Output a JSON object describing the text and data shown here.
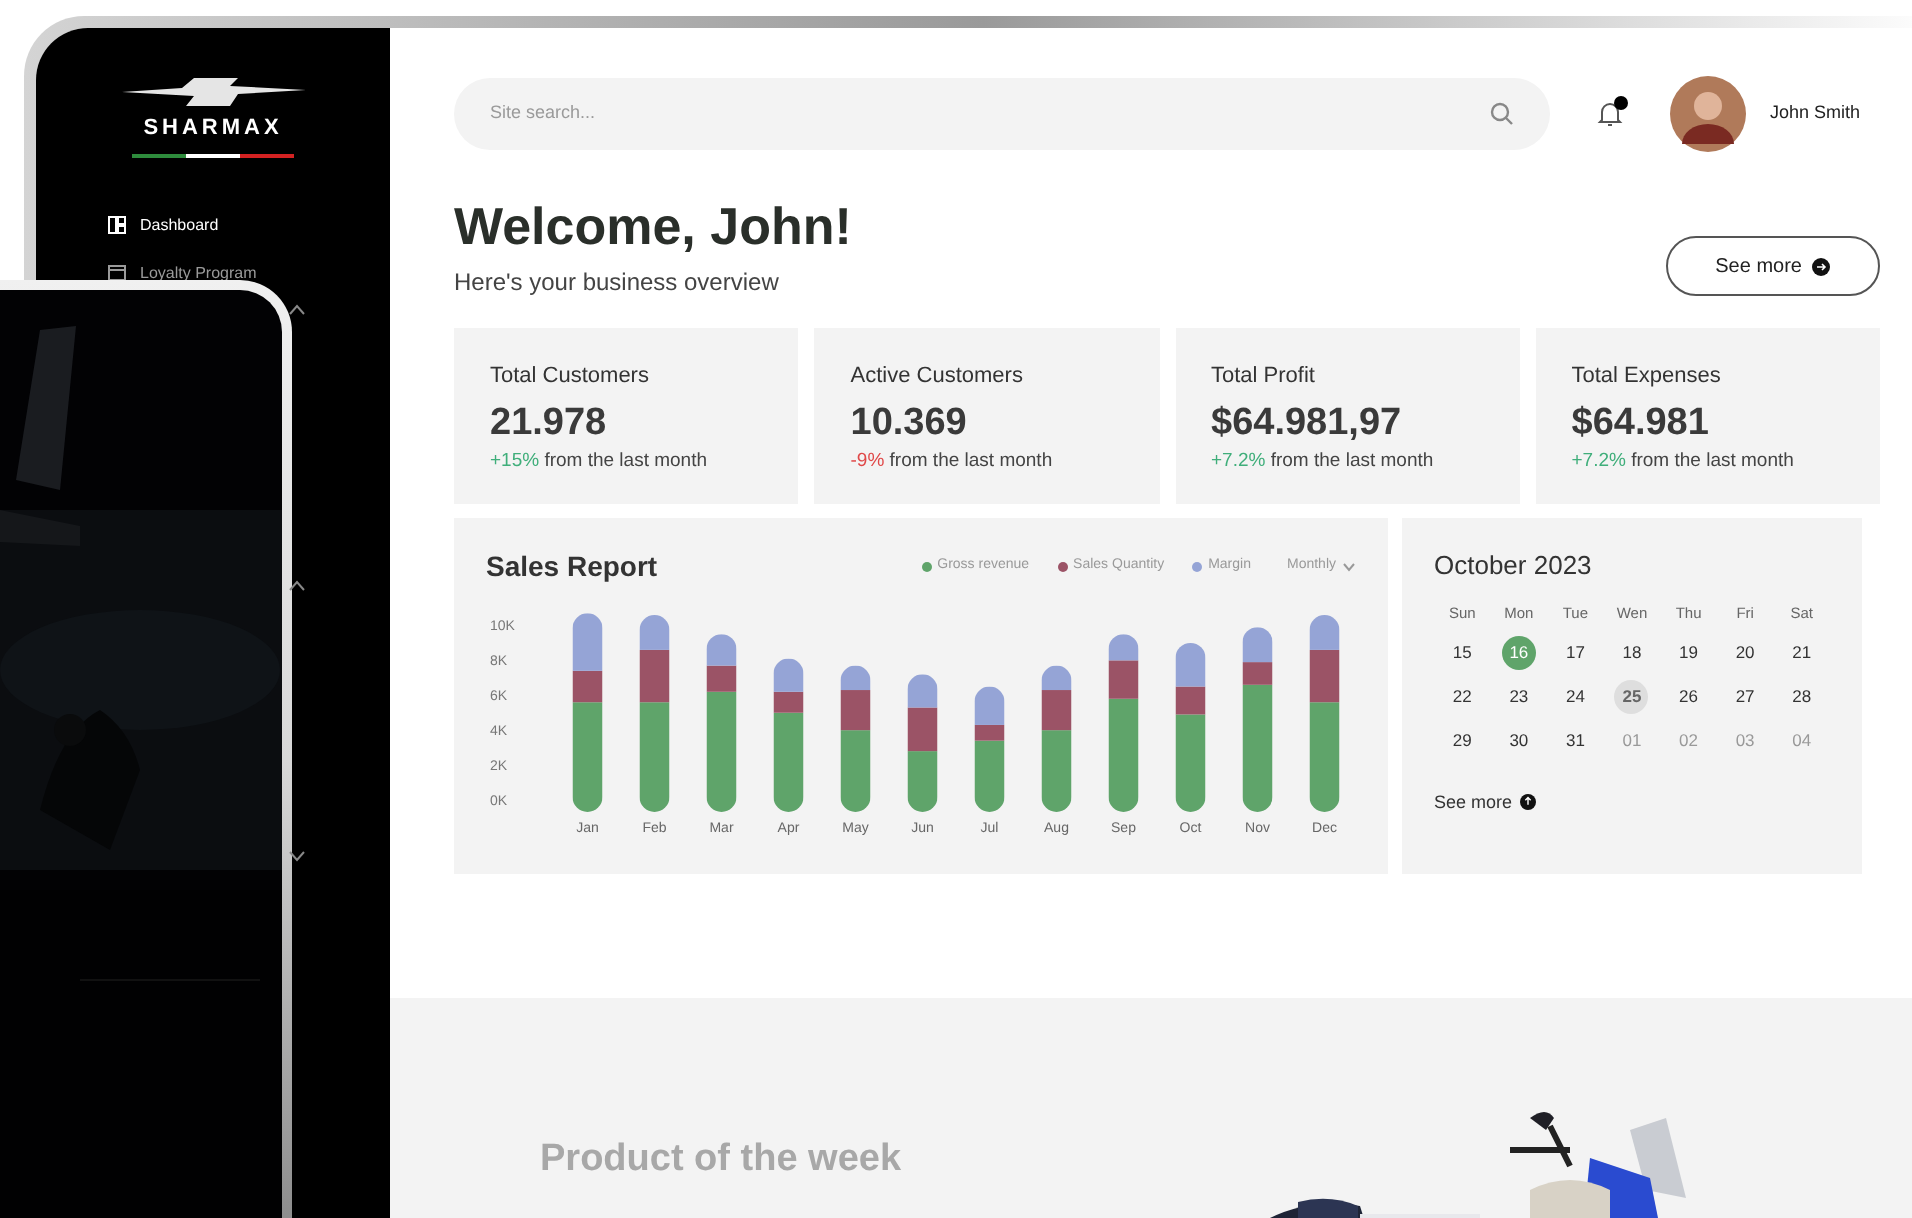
{
  "brand": {
    "name": "SHARMAX"
  },
  "sidebar": {
    "items": [
      {
        "label": "Dashboard",
        "selected": true
      },
      {
        "label": "Loyalty Program",
        "selected": false
      }
    ],
    "groups": [
      {
        "expanded": true
      },
      {
        "expanded": true
      },
      {
        "expanded": false
      }
    ]
  },
  "search": {
    "placeholder": "Site search..."
  },
  "user": {
    "name": "John Smith",
    "notifications": true
  },
  "header": {
    "title": "Welcome, John!",
    "subtitle": "Here's your business overview",
    "button": "See more"
  },
  "stats": [
    {
      "label": "Total Customers",
      "value": "21.978",
      "delta": "+15%",
      "color": "#3fae7a",
      "note": "from the last month"
    },
    {
      "label": "Active Customers",
      "value": "10.369",
      "delta": "-9%",
      "color": "#e04848",
      "note": "from the last month"
    },
    {
      "label": "Total Profit",
      "value": "$64.981,97",
      "delta": "+7.2%",
      "color": "#3fae7a",
      "note": "from the last month"
    },
    {
      "label": "Total Expenses",
      "value": "$64.981",
      "delta": "+7.2%",
      "color": "#3fae7a",
      "note": "from the last month"
    }
  ],
  "sales_report": {
    "title": "Sales Report",
    "period": "Monthly",
    "chart_data": {
      "type": "bar",
      "stacked": true,
      "categories": [
        "Jan",
        "Feb",
        "Mar",
        "Apr",
        "May",
        "Jun",
        "Jul",
        "Aug",
        "Sep",
        "Oct",
        "Nov",
        "Dec"
      ],
      "yticks": [
        {
          "value": 0,
          "label": "0K"
        },
        {
          "value": 2,
          "label": "2K"
        },
        {
          "value": 4,
          "label": "4K"
        },
        {
          "value": 6,
          "label": "6K"
        },
        {
          "value": 8,
          "label": "8K"
        },
        {
          "value": 10,
          "label": "10K"
        }
      ],
      "ylim": [
        0,
        11
      ],
      "series": [
        {
          "name": "Gross revenue",
          "color": "#5fa46a",
          "values": [
            5.6,
            5.6,
            6.2,
            5.0,
            4.0,
            2.8,
            3.4,
            4.0,
            5.8,
            4.9,
            6.6,
            5.6
          ]
        },
        {
          "name": "Sales Quantity",
          "color": "#9b5366",
          "values": [
            1.8,
            3.0,
            1.5,
            1.2,
            2.3,
            2.5,
            0.9,
            2.3,
            2.2,
            1.6,
            1.3,
            3.0
          ]
        },
        {
          "name": "Margin",
          "color": "#95a4d6",
          "values": [
            3.3,
            2.0,
            1.8,
            1.9,
            1.4,
            1.9,
            2.2,
            1.4,
            1.5,
            2.5,
            2.0,
            2.0
          ]
        }
      ]
    }
  },
  "calendar": {
    "title": "October 2023",
    "weekdays": [
      "Sun",
      "Mon",
      "Tue",
      "Wen",
      "Thu",
      "Fri",
      "Sat"
    ],
    "days": [
      {
        "label": "15",
        "selected": false,
        "marked": false,
        "outside": false
      },
      {
        "label": "16",
        "selected": true,
        "marked": false,
        "outside": false
      },
      {
        "label": "17",
        "selected": false,
        "marked": false,
        "outside": false
      },
      {
        "label": "18",
        "selected": false,
        "marked": false,
        "outside": false
      },
      {
        "label": "19",
        "selected": false,
        "marked": false,
        "outside": false
      },
      {
        "label": "20",
        "selected": false,
        "marked": false,
        "outside": false
      },
      {
        "label": "21",
        "selected": false,
        "marked": false,
        "outside": false
      },
      {
        "label": "22",
        "selected": false,
        "marked": false,
        "outside": false
      },
      {
        "label": "23",
        "selected": false,
        "marked": false,
        "outside": false
      },
      {
        "label": "24",
        "selected": false,
        "marked": false,
        "outside": false
      },
      {
        "label": "25",
        "selected": false,
        "marked": true,
        "outside": false
      },
      {
        "label": "26",
        "selected": false,
        "marked": false,
        "outside": false
      },
      {
        "label": "27",
        "selected": false,
        "marked": false,
        "outside": false
      },
      {
        "label": "28",
        "selected": false,
        "marked": false,
        "outside": false
      },
      {
        "label": "29",
        "selected": false,
        "marked": false,
        "outside": false
      },
      {
        "label": "30",
        "selected": false,
        "marked": false,
        "outside": false
      },
      {
        "label": "31",
        "selected": false,
        "marked": false,
        "outside": false
      },
      {
        "label": "01",
        "selected": false,
        "marked": false,
        "outside": true
      },
      {
        "label": "02",
        "selected": false,
        "marked": false,
        "outside": true
      },
      {
        "label": "03",
        "selected": false,
        "marked": false,
        "outside": true
      },
      {
        "label": "04",
        "selected": false,
        "marked": false,
        "outside": true
      }
    ],
    "link": "See more"
  },
  "product": {
    "heading": "Product of the week"
  }
}
